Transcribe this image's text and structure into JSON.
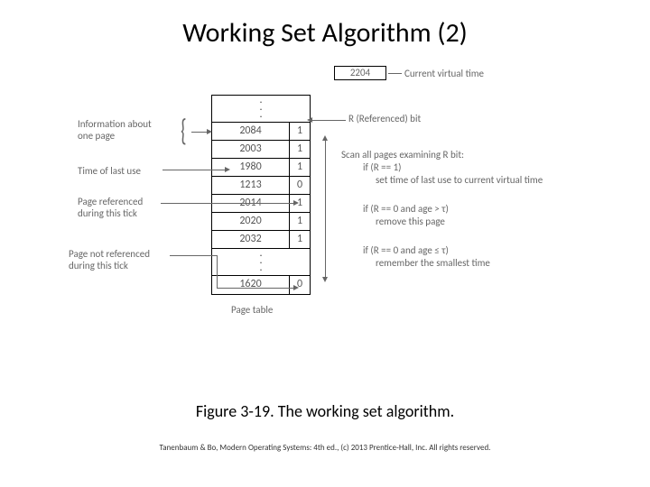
{
  "title": "Working Set Algorithm (2)",
  "current_time": {
    "value": "2204",
    "label": "Current virtual time"
  },
  "table": {
    "rows": [
      {
        "time": "2084",
        "r": "1"
      },
      {
        "time": "2003",
        "r": "1"
      },
      {
        "time": "1980",
        "r": "1"
      },
      {
        "time": "1213",
        "r": "0"
      },
      {
        "time": "2014",
        "r": "1"
      },
      {
        "time": "2020",
        "r": "1"
      },
      {
        "time": "2032",
        "r": "1"
      },
      {
        "time": "1620",
        "r": "0"
      }
    ],
    "caption": "Page table"
  },
  "left_labels": {
    "info": "Information about\none page",
    "time_last_use": "Time of last use",
    "page_ref": "Page referenced\nduring this tick",
    "page_not_ref": "Page not referenced\nduring this tick"
  },
  "right_labels": {
    "r_bit": "R (Referenced) bit",
    "scan_header": "Scan all pages examining R bit:",
    "cond1_a": "if (R == 1)",
    "cond1_b": "set time of last use to current virtual time",
    "cond2_a": "if (R == 0 and age > τ)",
    "cond2_b": "remove this page",
    "cond3_a": "if (R == 0 and age ≤ τ)",
    "cond3_b": "remember the smallest time"
  },
  "caption": "Figure 3-19. The working set algorithm.",
  "footer": "Tanenbaum & Bo, Modern Operating Systems: 4th ed., (c) 2013 Prentice-Hall, Inc. All rights reserved."
}
